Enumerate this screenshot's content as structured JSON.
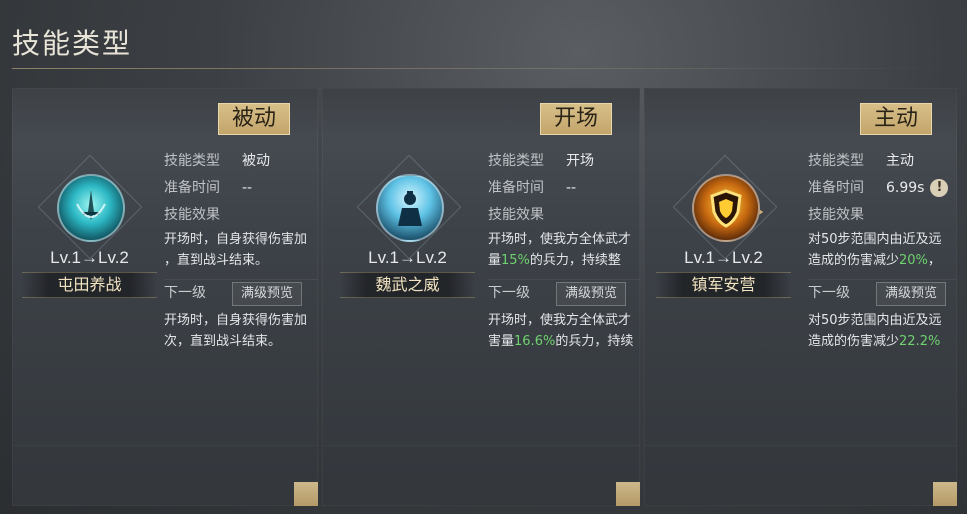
{
  "page": {
    "title": "技能类型"
  },
  "arrow_glyph": "→",
  "colors": {
    "accent_gold": "#c8aa6e",
    "highlight_green": "#6ed26e"
  },
  "cards": [
    {
      "tag": "被动",
      "icon": "sword-shield-icon",
      "level": "Lv.1→Lv.2",
      "name": "屯田养战",
      "type_label": "技能类型",
      "type_value": "被动",
      "prep_label": "准备时间",
      "prep_value": "--",
      "effect_label": "技能效果",
      "effect_lines": [
        "开场时，自身获得伤害加",
        "，直到战斗结束。"
      ],
      "next_label": "下一级",
      "max_button": "满级预览",
      "next_lines": [
        "开场时，自身获得伤害加",
        "次，直到战斗结束。"
      ]
    },
    {
      "tag": "开场",
      "icon": "general-figure-icon",
      "level": "Lv.1→Lv.2",
      "name": "魏武之威",
      "type_label": "技能类型",
      "type_value": "开场",
      "prep_label": "准备时间",
      "prep_value": "--",
      "effect_label": "技能效果",
      "effect_line1": "开场时，使我方全体武才",
      "effect_line2_pre": "量",
      "effect_line2_highlight": "15%",
      "effect_line2_post": "的兵力，持续整",
      "next_label": "下一级",
      "max_button": "满级预览",
      "next_line1": "开场时，使我方全体武才",
      "next_line2_pre": "害量",
      "next_line2_highlight": "16.6%",
      "next_line2_post": "的兵力，持续"
    },
    {
      "tag": "主动",
      "icon": "golden-shield-icon",
      "level": "Lv.1→Lv.2",
      "name": "镇军安营",
      "type_label": "技能类型",
      "type_value": "主动",
      "prep_label": "准备时间",
      "prep_value": "6.99s",
      "prep_info": "!",
      "effect_label": "技能效果",
      "effect_line1": "对50步范围内由近及远",
      "effect_line2_pre": "造成的伤害减少",
      "effect_line2_highlight": "20%",
      "effect_line2_post": "，",
      "next_label": "下一级",
      "max_button": "满级预览",
      "next_line1": "对50步范围内由近及远",
      "next_line2_pre": "造成的伤害减少",
      "next_line2_highlight": "22.2%"
    }
  ]
}
